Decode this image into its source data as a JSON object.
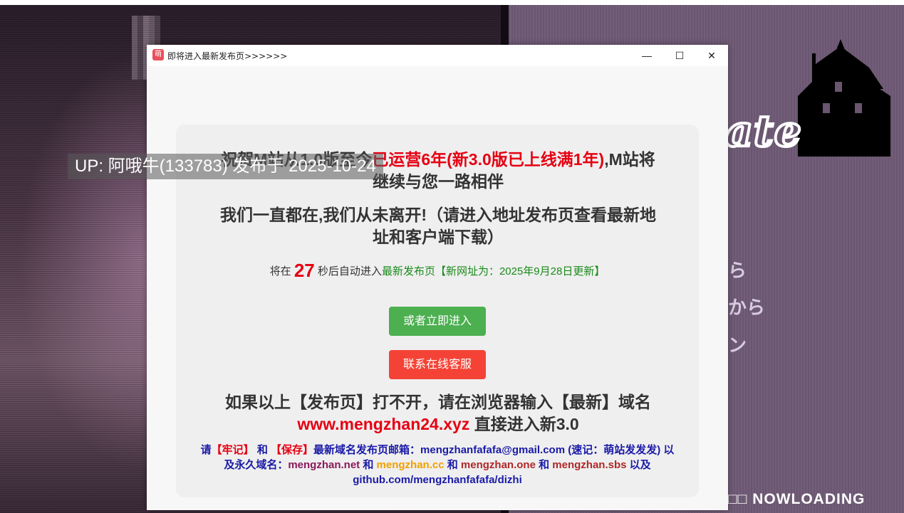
{
  "window": {
    "title": "即将进入最新发布页>>>>>>",
    "app_icon_text": "萌",
    "minimize_glyph": "—",
    "maximize_glyph": "☐",
    "close_glyph": "✕"
  },
  "card": {
    "headline1_a": "祝贺M站从1.0版至今",
    "headline1_red": "已运营6年(新3.0版已上线满1年)",
    "headline1_b": ",M站将继续与您一路相伴",
    "headline2": "我们一直都在,我们从未离开!（请进入地址发布页查看最新地址和客户端下载）",
    "countdown_prefix": "将在",
    "countdown_value": "27",
    "countdown_suffix": "秒后自动进入",
    "countdown_link": "最新发布页【新网址为：2025年9月28日更新】",
    "enter_button": "或者立即进入",
    "service_button": "联系在线客服",
    "fallback_line": "如果以上【发布页】打不开，请在浏览器输入【最新】域名",
    "fallback_domain": "www.mengzhan24.xyz",
    "fallback_tail": "直接进入新3.0",
    "note_prefix": "请",
    "note_keep": "【牢记】",
    "note_and1": "和",
    "note_save": "【保存】",
    "note_mail_label": "最新域名发布页邮箱：mengzhanfafafa@gmail.com (速记：萌站发发发) 以及永久域名：",
    "note_domain1": "mengzhan.net",
    "note_and2": "和",
    "note_domain2": "mengzhan.cc",
    "note_and3": "和",
    "note_domain3": "mengzhan.one",
    "note_and4": "和",
    "note_domain4": "mengzhan.sbs",
    "note_tail": "以及 github.com/mengzhanfafafa/dizhi"
  },
  "overlay": {
    "uploader_text": "UP: 阿哦牛(133783) 发布于 2025-10-24"
  },
  "background": {
    "logo_text": "ate",
    "jp_line1": "ら",
    "jp_line2": "から",
    "jp_line3": "ン",
    "loading_text": "□□ NOWLOADING"
  }
}
